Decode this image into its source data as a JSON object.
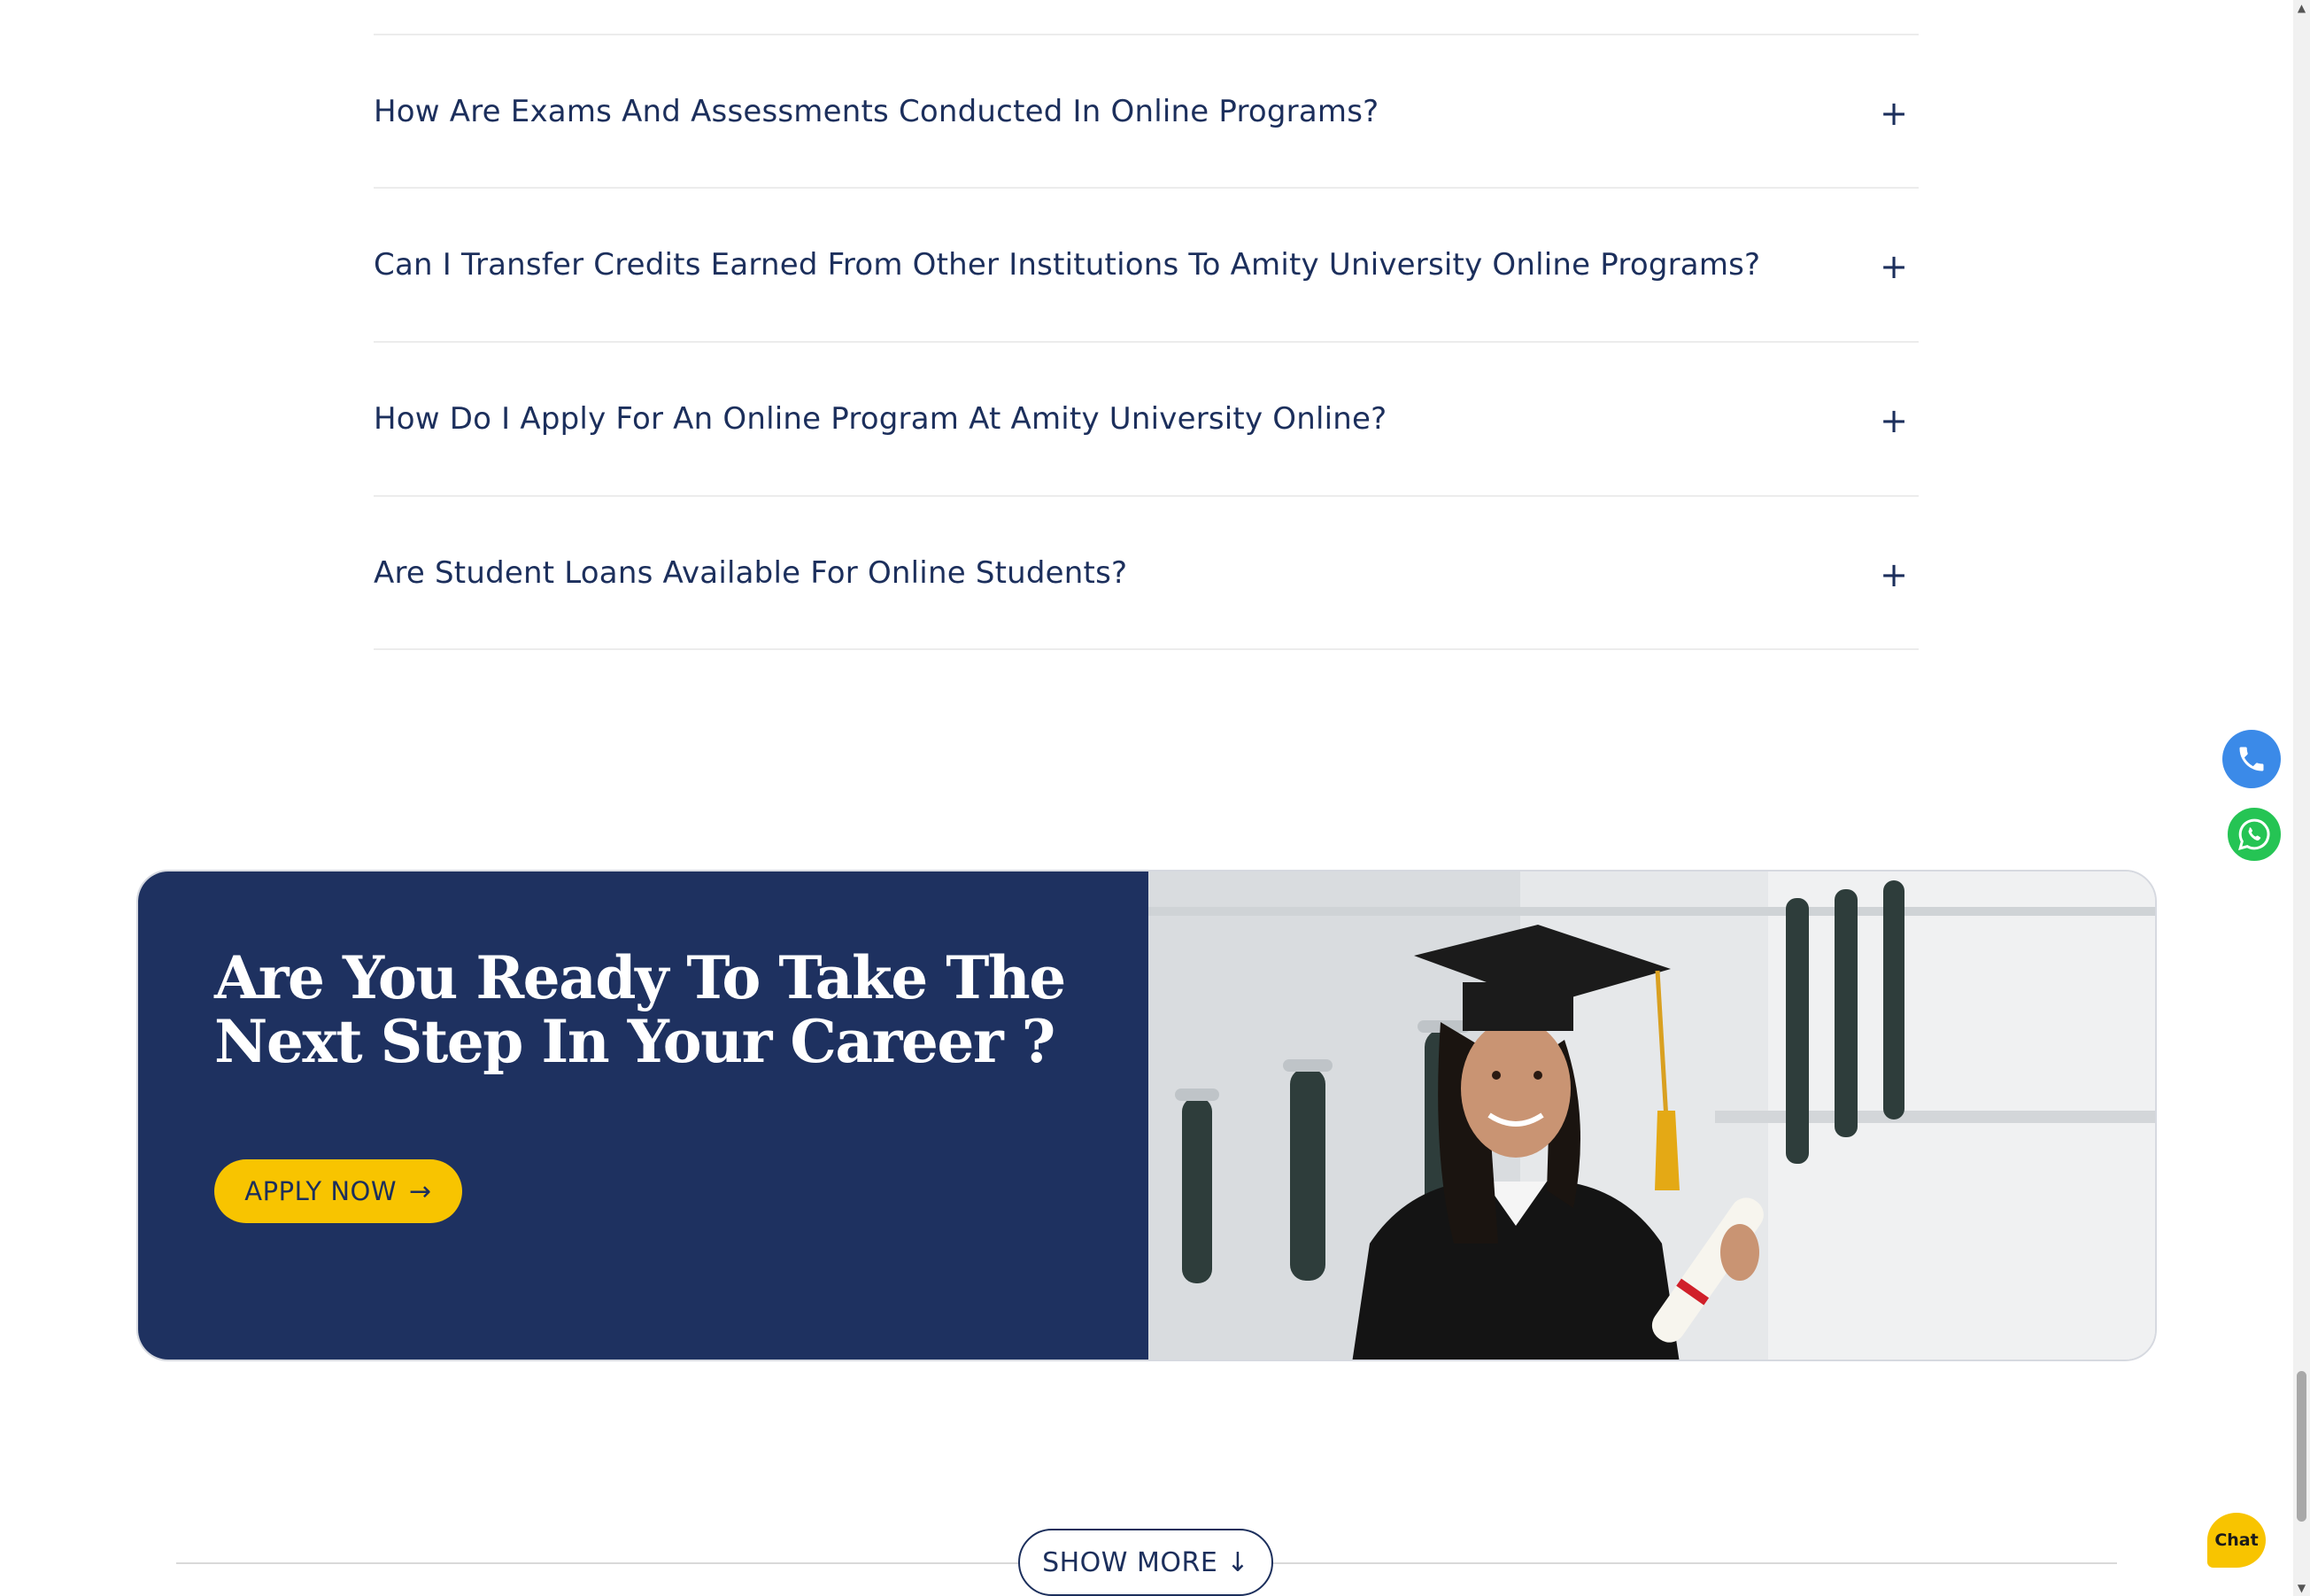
{
  "faq": {
    "items": [
      {
        "question": "How Are Exams And Assessments Conducted In Online Programs?",
        "toggle": "+"
      },
      {
        "question": "Can I Transfer Credits Earned From Other Institutions To Amity University Online Programs?",
        "toggle": "+"
      },
      {
        "question": "How Do I Apply For An Online Program At Amity University Online?",
        "toggle": "+"
      },
      {
        "question": "Are Student Loans Available For Online Students?",
        "toggle": "+"
      }
    ]
  },
  "cta": {
    "title": "Are You Ready To Take The Next Step In Your Career ?",
    "button_label": "APPLY NOW",
    "button_icon": "arrow-right-icon",
    "image_alt": "graduate-photo"
  },
  "floating": {
    "phone_icon": "phone-icon",
    "whatsapp_icon": "whatsapp-icon",
    "chat_label": "Chat"
  },
  "show_more": {
    "label": "SHOW MORE",
    "icon": "arrow-down-icon"
  },
  "colors": {
    "navy": "#1e3160",
    "yellow": "#f8c400",
    "text": "#1c2f5c",
    "phone": "#3b8ae8",
    "whatsapp": "#25c454"
  }
}
